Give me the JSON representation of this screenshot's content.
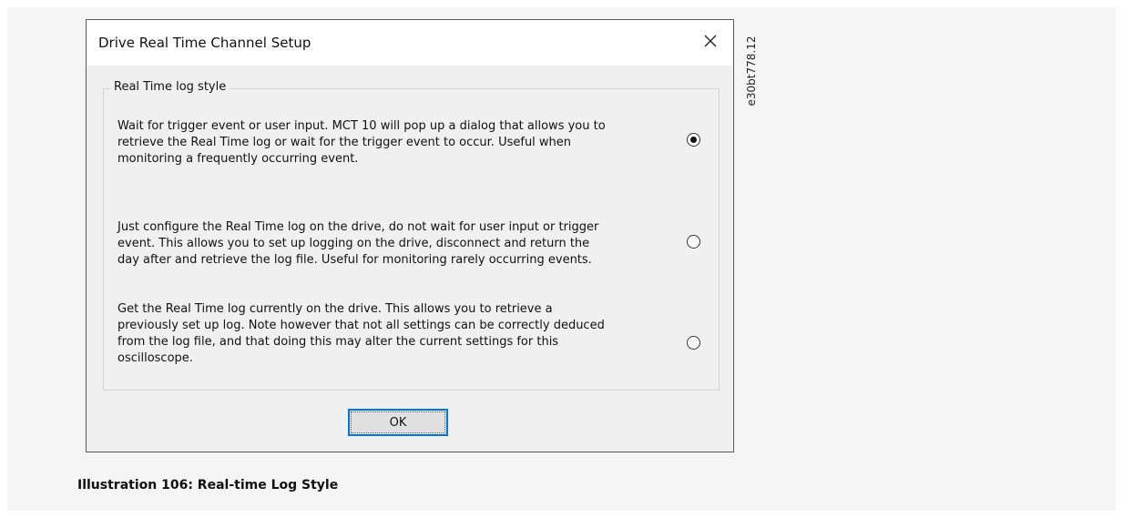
{
  "dialog": {
    "title": "Drive Real Time Channel Setup",
    "close_icon": "close-icon",
    "group": {
      "legend": "Real Time log style",
      "options": [
        {
          "lines": [
            "Wait for trigger event or user input. MCT 10 will pop up a dialog that allows you to",
            "retrieve the Real Time log or wait for the trigger event to occur. Useful when",
            "monitoring a frequently occurring event."
          ],
          "selected": true
        },
        {
          "lines": [
            "Just configure the Real Time log on the drive, do not wait for user input or trigger",
            "event. This allows you to set up logging on the drive, disconnect and return the",
            "day after and retrieve the log file. Useful for monitoring rarely occurring events."
          ],
          "selected": false
        },
        {
          "lines": [
            "Get the Real Time log currently on the drive. This allows you to retrieve a",
            "previously set up log. Note however that not all settings can be correctly deduced",
            "from the log file, and that doing this may alter the current settings for this",
            "oscilloscope."
          ],
          "selected": false
        }
      ]
    },
    "ok_label": "OK"
  },
  "figure": {
    "code": "e30bt778.12",
    "caption": "Illustration 106: Real-time Log Style"
  },
  "colors": {
    "focus_border": "#0078d7",
    "dialog_bg": "#f0f0f0",
    "titlebar_bg": "#ffffff"
  }
}
